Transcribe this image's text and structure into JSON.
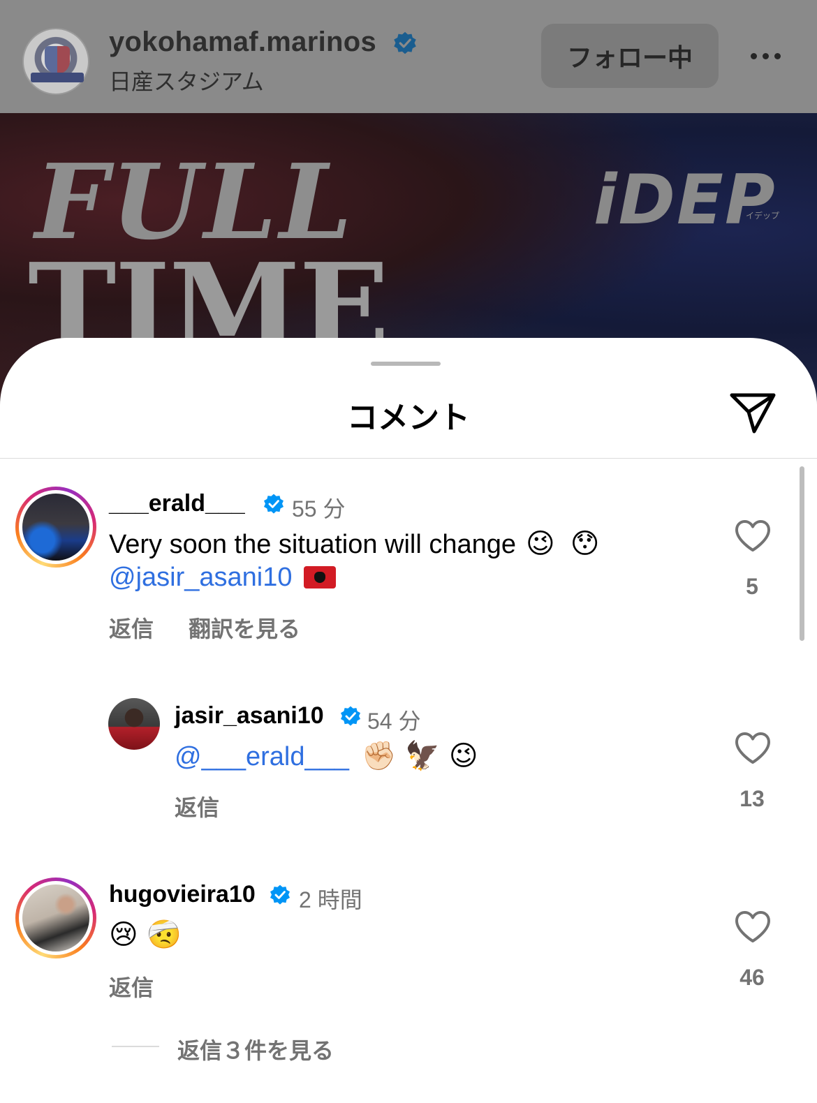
{
  "post_header": {
    "username": "yokohamaf.marinos",
    "location": "日産スタジアム",
    "follow_label": "フォロー中"
  },
  "post_image": {
    "line1": "FULL",
    "line2": "TIME",
    "brand": "iDEP",
    "brand_sub": "イデップ"
  },
  "sheet": {
    "title": "コメント"
  },
  "comments": [
    {
      "username": "___erald___",
      "time": "55 分",
      "text": "Very soon the situation will change",
      "emoji1": "😉",
      "emoji2": "😯",
      "mention": "@jasir_asani10",
      "flag": "🇦🇱",
      "reply_label": "返信",
      "translate_label": "翻訳を見る",
      "likes": "5"
    },
    {
      "username": "jasir_asani10",
      "time": "54 分",
      "mention": "@___erald___",
      "emojis": "✊🏻 🦅 😉",
      "reply_label": "返信",
      "likes": "13"
    },
    {
      "username": "hugovieira10",
      "time": "2 時間",
      "emojis": "😢 🤕",
      "reply_label": "返信",
      "likes": "46"
    }
  ],
  "view_replies_label": "返信３件を見る",
  "colors": {
    "verified": "#0095f6",
    "mention": "#2f6fe0",
    "secondary_text": "#737373"
  },
  "icons": [
    "verified-badge-icon",
    "more-icon",
    "share-icon",
    "heart-icon"
  ]
}
